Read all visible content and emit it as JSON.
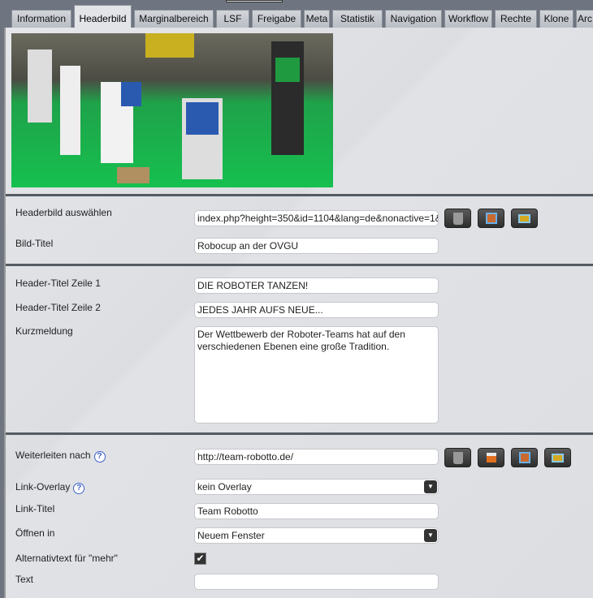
{
  "tabs": [
    "Information",
    "Headerbild",
    "Marginalbereich",
    "LSF",
    "Freigabe",
    "Meta",
    "Statistik",
    "Navigation",
    "Workflow",
    "Rechte",
    "Klone",
    "Arc"
  ],
  "active_tab": "Headerbild",
  "header_image": {
    "label": "Headerbild auswählen",
    "value": "index.php?height=350&id=1104&lang=de&nonactive=1&",
    "title_label": "Bild-Titel",
    "title_value": "Robocup an der OVGU"
  },
  "header_text": {
    "line1_label": "Header-Titel Zeile 1",
    "line1_value": "DIE ROBOTER TANZEN!",
    "line2_label": "Header-Titel Zeile 2",
    "line2_value": "JEDES JAHR AUFS NEUE...",
    "short_label": "Kurzmeldung",
    "short_value": "Der Wettbewerb der Roboter-Teams hat auf den verschiedenen Ebenen eine große Tradition."
  },
  "link": {
    "redirect_label": "Weiterleiten nach",
    "redirect_value": "http://team-robotto.de/",
    "overlay_label": "Link-Overlay",
    "overlay_value": "kein Overlay",
    "title_label": "Link-Titel",
    "title_value": "Team Robotto",
    "open_label": "Öffnen in",
    "open_value": "Neuem Fenster",
    "alt_label": "Alternativtext für \"mehr\"",
    "alt_checked": true,
    "text_label": "Text",
    "text_value": "",
    "help_glyph": "?"
  },
  "icons": [
    "trash-icon",
    "home-icon",
    "image-browser-icon",
    "image-gallery-icon",
    "help-icon",
    "chevron-down-icon",
    "checkmark-icon"
  ]
}
